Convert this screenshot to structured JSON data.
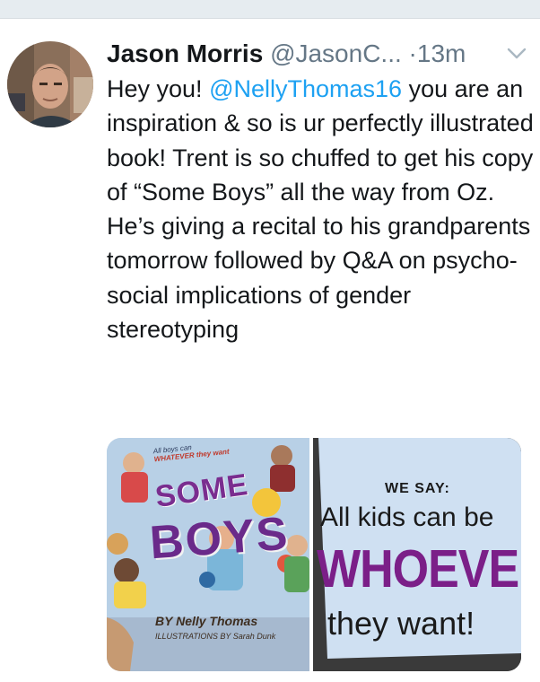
{
  "tweet": {
    "author_name": "Jason Morris",
    "handle": "@JasonC...",
    "separator": "·",
    "time": "13m",
    "text_segments": [
      {
        "text": "Hey you! ",
        "type": "text"
      },
      {
        "text": "@NellyThomas16",
        "type": "mention"
      },
      {
        "text": " you are an inspiration & so is ur perfectly illustrated book! Trent is so chuffed to get his copy of “Some Boys” all the way from Oz. He’s giving a recital to his grandparents tomorrow followed by Q&A on psycho-social implications of gender stereotyping",
        "type": "text"
      }
    ],
    "menu_icon": "chevron-down-icon"
  },
  "media": {
    "left": {
      "title_top": "SOME",
      "title_bottom": "BOYS",
      "tagline_top": "All boys can",
      "tagline_bottom": "WHATEVER they want",
      "author": "BY Nelly Thomas",
      "illustrator": "ILLUSTRATIONS BY Sarah Dunk"
    },
    "right": {
      "line1": "WE SAY:",
      "line2": "All kids can be",
      "line3": "WHOEVER",
      "line4": "they want!"
    }
  },
  "colors": {
    "mention": "#1da1f2",
    "secondary_text": "#657786",
    "topbar": "#e6ecf0"
  }
}
